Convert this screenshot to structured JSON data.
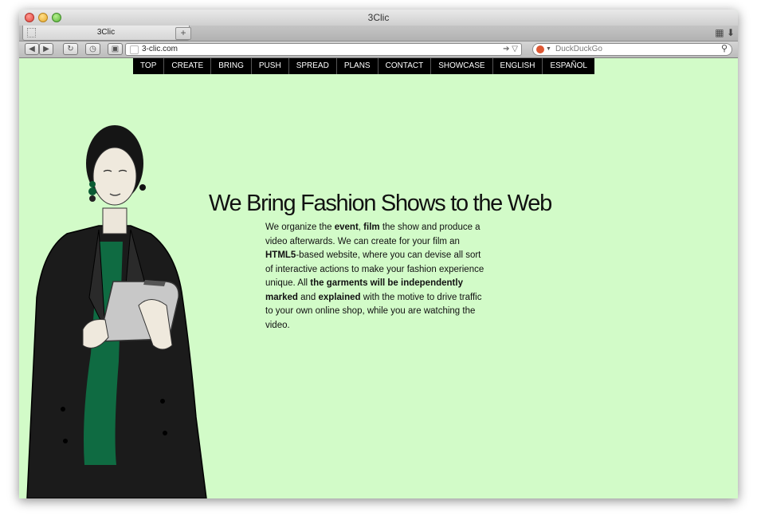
{
  "window": {
    "title": "3Clic",
    "tab": {
      "label": "3Clic"
    },
    "new_tab_symbol": "+",
    "address": "3-clic.com",
    "address_icons": "➔ ▽",
    "search_placeholder": "DuckDuckGo"
  },
  "toolbar": {
    "back": "◀",
    "forward": "▶",
    "reload": "↻",
    "history": "◷",
    "bookmark": "▣",
    "caret": "▼",
    "magnifier": "⚲",
    "grid": "▦",
    "download": "⬇"
  },
  "nav": {
    "items": [
      "TOP",
      "CREATE",
      "BRING",
      "PUSH",
      "SPREAD",
      "PLANS",
      "CONTACT",
      "SHOWCASE",
      "ENGLISH",
      "ESPAÑOL"
    ]
  },
  "main": {
    "headline": "We Bring Fashion Shows to the Web",
    "paragraph": {
      "p1": "We organize the ",
      "b1": "event",
      "p2": ", ",
      "b2": "film",
      "p3": " the show and produce a video afterwards. We can create for your film an ",
      "b3": "HTML5",
      "p4": "-based website, where you can devise all sort of interactive actions to make your fashion experience unique. All ",
      "b4": "the garments will be independently marked",
      "p5": " and ",
      "b5": "explained",
      "p6": " with the motive to drive traffic to your own online shop, while you are watching the video."
    }
  },
  "colors": {
    "page_bg": "#d2fbc8",
    "nav_bg": "#000000",
    "nav_text": "#ffffff",
    "text": "#111111"
  }
}
